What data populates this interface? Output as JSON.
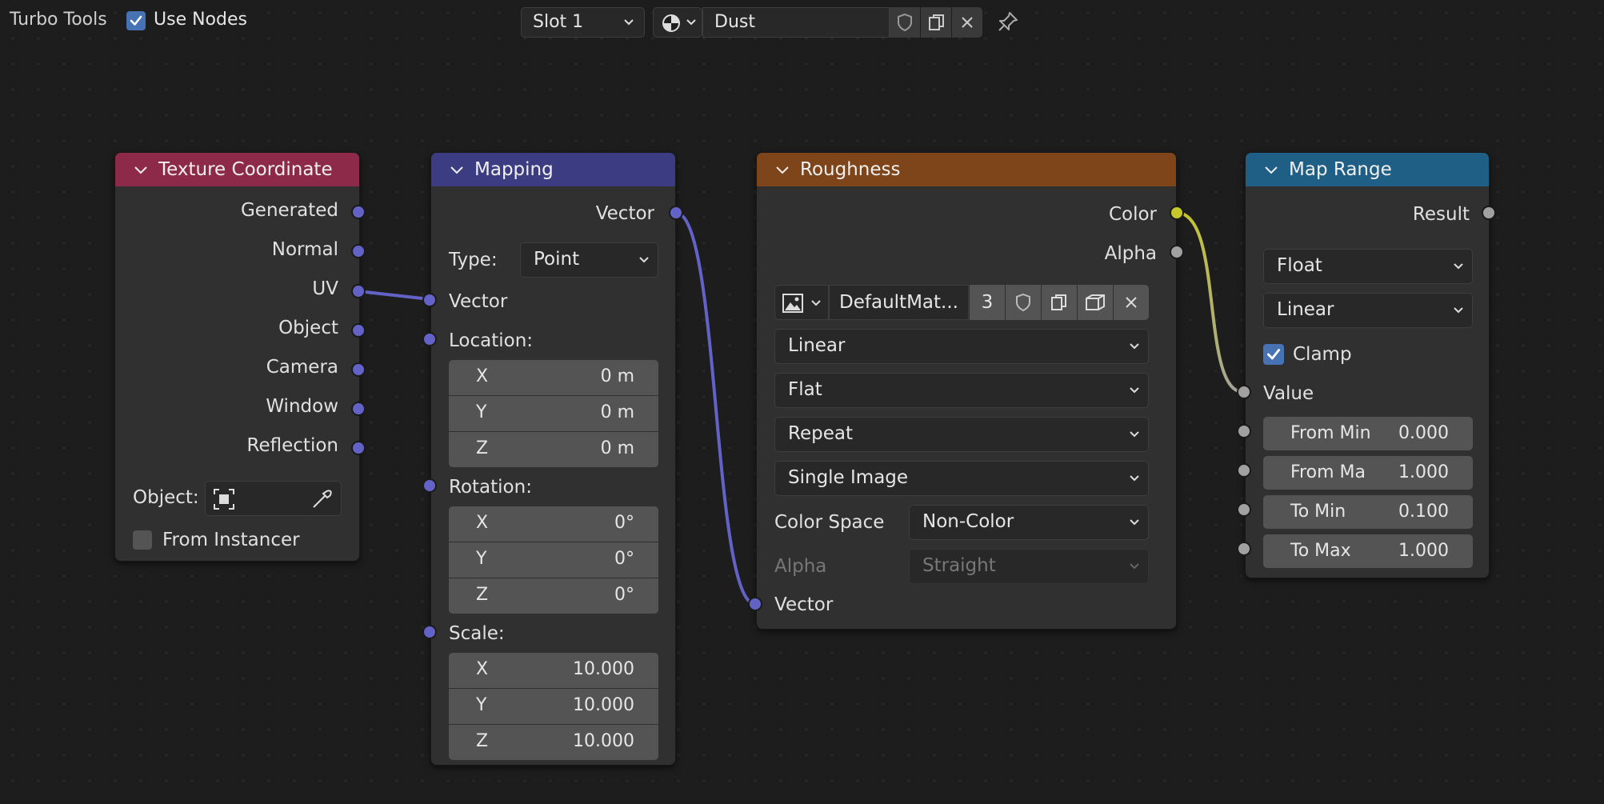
{
  "toolbar": {
    "app_label": "Turbo Tools",
    "use_nodes_label": "Use Nodes",
    "use_nodes_checked": true,
    "slot_label": "Slot 1",
    "material_name": "Dust"
  },
  "nodes": {
    "texture_coordinate": {
      "title": "Texture Coordinate",
      "header_color": "#8e2a49",
      "outputs": [
        "Generated",
        "Normal",
        "UV",
        "Object",
        "Camera",
        "Window",
        "Reflection"
      ],
      "object_label": "Object:",
      "from_instancer_label": "From Instancer",
      "from_instancer_checked": false
    },
    "mapping": {
      "title": "Mapping",
      "header_color": "#3c3c83",
      "output_label": "Vector",
      "type_label": "Type:",
      "type_value": "Point",
      "vector_input_label": "Vector",
      "location_label": "Location:",
      "location": [
        {
          "axis": "X",
          "value": "0 m"
        },
        {
          "axis": "Y",
          "value": "0 m"
        },
        {
          "axis": "Z",
          "value": "0 m"
        }
      ],
      "rotation_label": "Rotation:",
      "rotation": [
        {
          "axis": "X",
          "value": "0°"
        },
        {
          "axis": "Y",
          "value": "0°"
        },
        {
          "axis": "Z",
          "value": "0°"
        }
      ],
      "scale_label": "Scale:",
      "scale": [
        {
          "axis": "X",
          "value": "10.000"
        },
        {
          "axis": "Y",
          "value": "10.000"
        },
        {
          "axis": "Z",
          "value": "10.000"
        }
      ]
    },
    "roughness": {
      "title": "Roughness",
      "header_color": "#7d4519",
      "outputs": [
        "Color",
        "Alpha"
      ],
      "image_name": "DefaultMat...",
      "user_count": "3",
      "interpolation": "Linear",
      "projection": "Flat",
      "extension": "Repeat",
      "source": "Single Image",
      "color_space_label": "Color Space",
      "color_space_value": "Non-Color",
      "alpha_label": "Alpha",
      "alpha_value": "Straight",
      "vector_input_label": "Vector"
    },
    "map_range": {
      "title": "Map Range",
      "header_color": "#1f5f85",
      "output_label": "Result",
      "data_type": "Float",
      "interpolation": "Linear",
      "clamp_label": "Clamp",
      "clamp_checked": true,
      "value_label": "Value",
      "fields": [
        {
          "label": "From Min",
          "value": "0.000"
        },
        {
          "label": "From Ma",
          "value": "1.000"
        },
        {
          "label": "To Min",
          "value": "0.100"
        },
        {
          "label": "To Max",
          "value": "1.000"
        }
      ]
    }
  },
  "colors": {
    "vector_socket": "#6363c7",
    "color_socket": "#c7c729",
    "float_socket": "#a1a1a1",
    "checkbox_accent": "#4772b3"
  }
}
